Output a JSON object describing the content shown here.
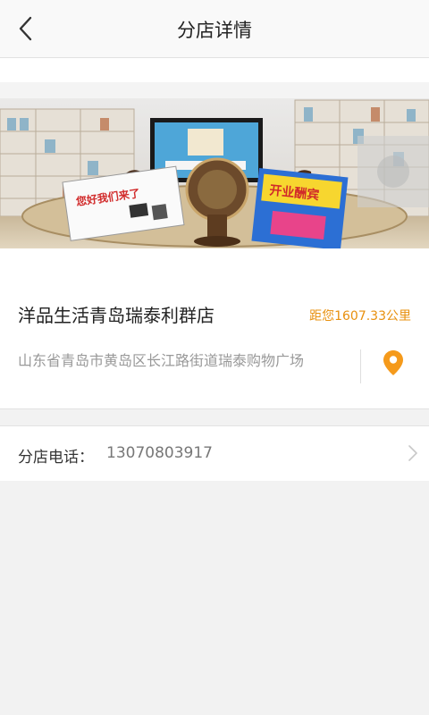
{
  "header": {
    "title": "分店详情"
  },
  "store": {
    "name": "洋品生活青岛瑞泰利群店",
    "distance": "距您1607.33公里",
    "address": "山东省青岛市黄岛区长江路街道瑞泰购物广场",
    "photo": {
      "poster_left": "您好我们来了",
      "poster_right": "开业酬宾"
    }
  },
  "phone": {
    "label": "分店电话：",
    "value": "13070803917"
  },
  "colors": {
    "accent": "#e8900e",
    "background": "#f2f2f2"
  }
}
